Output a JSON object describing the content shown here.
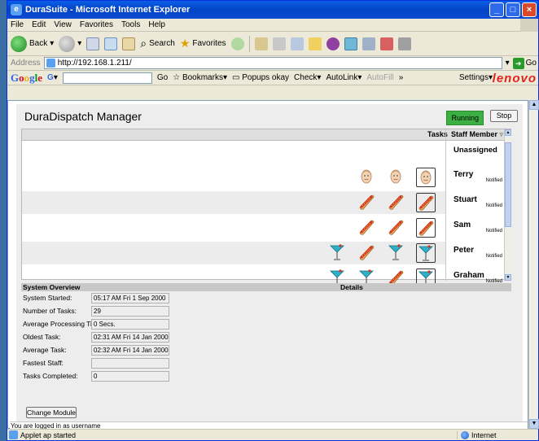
{
  "window": {
    "title": "DuraSuite - Microsoft Internet Explorer",
    "icon": "ie-icon"
  },
  "menubar": [
    "File",
    "Edit",
    "View",
    "Favorites",
    "Tools",
    "Help"
  ],
  "toolbar": {
    "back": "Back",
    "search": "Search",
    "favorites": "Favorites"
  },
  "address": {
    "label": "Address",
    "value": "http://192.168.1.211/",
    "go": "Go"
  },
  "googlebar": {
    "logo": "Google",
    "g_label": "G",
    "go_label": "Go",
    "bookmarks": "Bookmarks",
    "popups": "Popups okay",
    "check": "Check",
    "autolink": "AutoLink",
    "autofill": "AutoFill",
    "more": "»",
    "settings": "Settings",
    "brand": "lenovo"
  },
  "app": {
    "title": "DuraDispatch Manager",
    "status": "Running",
    "stop_label": "Stop",
    "status_color": "#3cb043"
  },
  "grid": {
    "tasks_header": "Tasks",
    "staff_header": "Staff Member",
    "unassigned": "Unassigned",
    "rows": [
      {
        "name": "Terry",
        "notified": "Notified",
        "tasks": [
          "face",
          "face",
          "face"
        ],
        "selected_last": true
      },
      {
        "name": "Stuart",
        "notified": "Notified",
        "tasks": [
          "hotdog",
          "hotdog",
          "hotdog"
        ],
        "selected_last": true
      },
      {
        "name": "Sam",
        "notified": "Notified",
        "tasks": [
          "hotdog",
          "hotdog",
          "hotdog"
        ],
        "selected_last": true
      },
      {
        "name": "Peter",
        "notified": "Notified",
        "tasks": [
          "cocktail",
          "hotdog",
          "cocktail",
          "cocktail"
        ],
        "selected_last": true
      },
      {
        "name": "Graham",
        "notified": "Notified",
        "tasks": [
          "cocktail",
          "cocktail",
          "hotdog",
          "cocktail"
        ],
        "selected_last": true
      }
    ]
  },
  "overview": {
    "header": "System Overview",
    "items": [
      {
        "label": "System Started:",
        "value": "05:17 AM Fri 1 Sep 2000"
      },
      {
        "label": "Number of Tasks:",
        "value": "29"
      },
      {
        "label": "Average Processing Time:",
        "value": "0 Secs."
      },
      {
        "label": "Oldest Task:",
        "value": "02:31 AM Fri 14 Jan 2000"
      },
      {
        "label": "Average Task:",
        "value": "02:32 AM Fri 14 Jan 2000"
      },
      {
        "label": "Fastest Staff:",
        "value": ""
      },
      {
        "label": "Tasks Completed:",
        "value": "0"
      }
    ]
  },
  "details": {
    "header": "Details"
  },
  "change_module_label": "Change Module",
  "logged_in_text": "You are logged in as username",
  "statusbar": {
    "left": "Applet ap started",
    "zone": "Internet"
  }
}
